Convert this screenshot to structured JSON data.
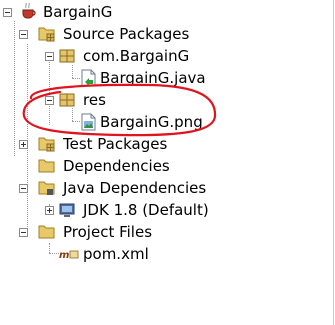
{
  "tree": {
    "root": {
      "label": "BargainG",
      "icon": "coffee-cup-project-icon"
    },
    "source_packages": {
      "label": "Source Packages",
      "icon": "package-folder-icon"
    },
    "pkg_bargaing": {
      "label": "com.BargainG",
      "icon": "package-icon"
    },
    "file_java": {
      "label": "BargainG.java",
      "icon": "java-file-icon"
    },
    "pkg_res": {
      "label": "res",
      "icon": "package-icon"
    },
    "file_png": {
      "label": "BargainG.png",
      "icon": "image-file-icon"
    },
    "test_packages": {
      "label": "Test Packages",
      "icon": "package-folder-icon"
    },
    "dependencies": {
      "label": "Dependencies",
      "icon": "folder-icon"
    },
    "java_dependencies": {
      "label": "Java Dependencies",
      "icon": "folder-icon"
    },
    "jdk": {
      "label": "JDK 1.8 (Default)",
      "icon": "jdk-icon"
    },
    "project_files": {
      "label": "Project Files",
      "icon": "folder-icon"
    },
    "pom": {
      "label": "pom.xml",
      "icon": "maven-icon"
    }
  },
  "annotation": {
    "color": "#e0141e"
  },
  "colors": {
    "selection_outline": "#e0141e",
    "folder": "#e8c96a",
    "package": "#d9b25c"
  }
}
